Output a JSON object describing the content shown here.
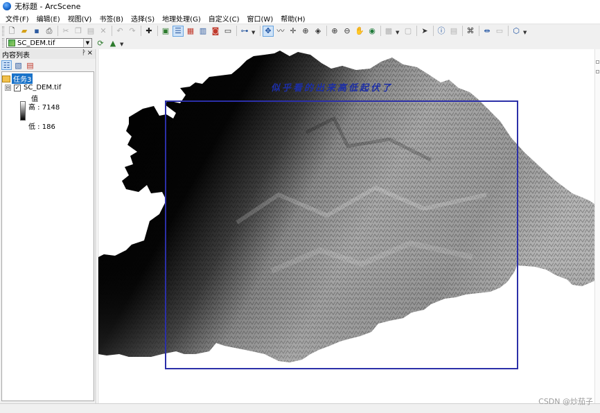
{
  "window": {
    "title": "无标题 - ArcScene"
  },
  "menubar": {
    "items": [
      "文件(F)",
      "编辑(E)",
      "视图(V)",
      "书签(B)",
      "选择(S)",
      "地理处理(G)",
      "自定义(C)",
      "窗口(W)",
      "帮助(H)"
    ]
  },
  "layer_toolbar": {
    "selected_layer": "SC_DEM.tif"
  },
  "toc": {
    "title": "内容列表",
    "pin_glyph": "ᚹ",
    "close_glyph": "×",
    "scene_name": "任务3",
    "layer": {
      "name": "SC_DEM.tif",
      "expander": "⊟",
      "checked": "✓",
      "legend_heading": "值",
      "high_label": "高 : 7148",
      "low_label": "低 : 186"
    }
  },
  "view": {
    "caption": "似乎看的出来高低起伏了"
  },
  "watermark": "CSDN @炒茄子",
  "colors": {
    "caption": "#1c2ea6",
    "frame": "#2b2fa8",
    "selection": "#1a73c9",
    "toolbar_bg": "#f0f0f0"
  }
}
